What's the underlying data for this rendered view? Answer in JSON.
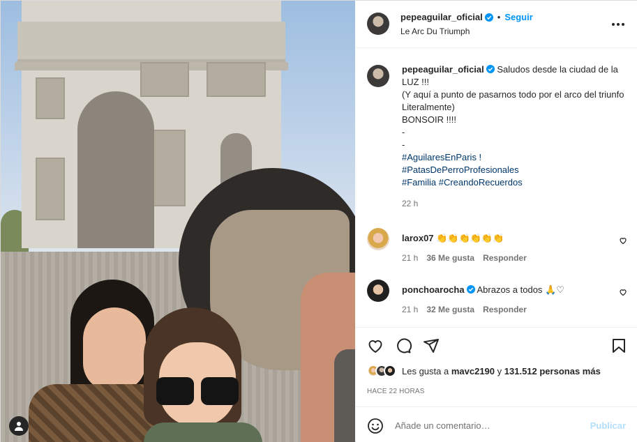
{
  "post": {
    "author": "pepeaguilar_oficial",
    "follow_label": "Seguir",
    "separator": "•",
    "location": "Le Arc Du Triumph"
  },
  "caption": {
    "author": "pepeaguilar_oficial",
    "lines": [
      "Saludos desde la ciudad de la LUZ !!!",
      "(Y aquí a punto de pasarnos todo por el arco del triunfo Literalmente)",
      "BONSOIR !!!!",
      "-",
      "-"
    ],
    "hashtags": [
      "#AguilaresEnParis !",
      "#PatasDePerroProfesionales",
      "#Familia #CreandoRecuerdos"
    ],
    "time": "22 h"
  },
  "comments": [
    {
      "user": "larox07",
      "text": "👏👏👏👏👏👏",
      "time": "21 h",
      "likes": "36 Me gusta",
      "reply": "Responder"
    },
    {
      "user": "ponchoarocha",
      "text": "Abrazos a todos 🙏♡",
      "time": "21 h",
      "likes": "32 Me gusta",
      "reply": "Responder"
    }
  ],
  "likes": {
    "prefix": "Les gusta a",
    "user": "mavc2190",
    "middle": "y",
    "count": "131.512 personas más"
  },
  "posted_ago": "HACE 22 HORAS",
  "add_comment": {
    "placeholder": "Añade un comentario…",
    "post_label": "Publicar"
  },
  "colors": {
    "accent": "#0095f6",
    "hashtag": "#00376b",
    "muted": "#737373",
    "post_disabled": "#b2dffc"
  }
}
